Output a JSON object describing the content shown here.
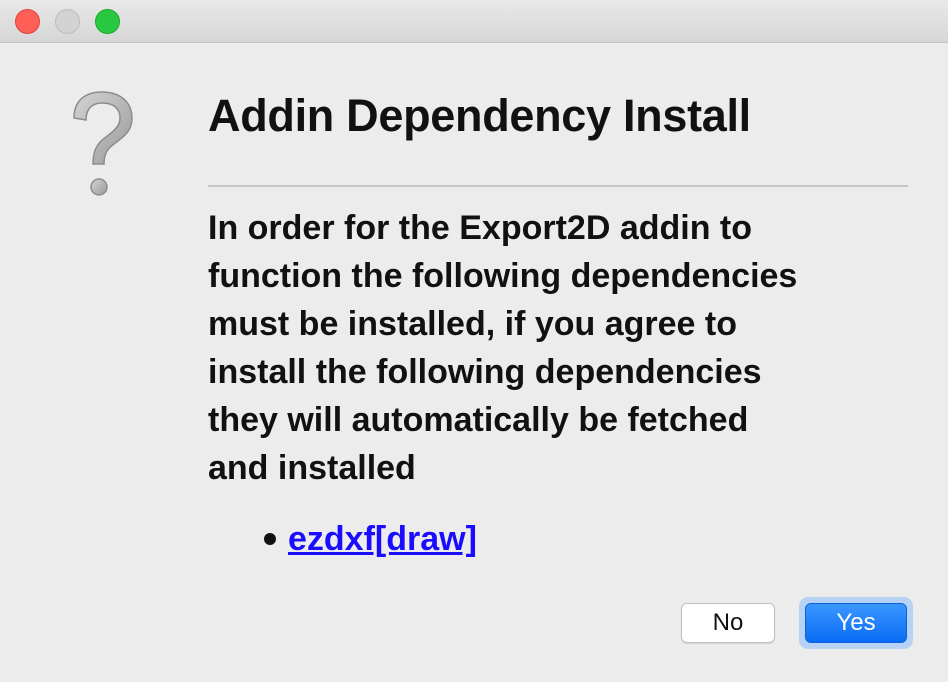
{
  "window": {
    "controls": [
      "close",
      "minimize",
      "maximize"
    ]
  },
  "dialog": {
    "icon": "question-mark-icon",
    "title": "Addin Dependency Install",
    "message_lines": [
      "In order for the Export2D addin to",
      "function the following dependencies",
      "must be installed, if you agree to",
      "install the following dependencies",
      "they will automatically be fetched",
      "and installed"
    ],
    "dependencies": [
      "ezdxf[draw]"
    ],
    "buttons": {
      "no_label": "No",
      "yes_label": "Yes"
    }
  },
  "colors": {
    "accent": "#0a6cf6",
    "link": "#1a0dff",
    "close": "#fe5f57",
    "maximize": "#28c840"
  }
}
